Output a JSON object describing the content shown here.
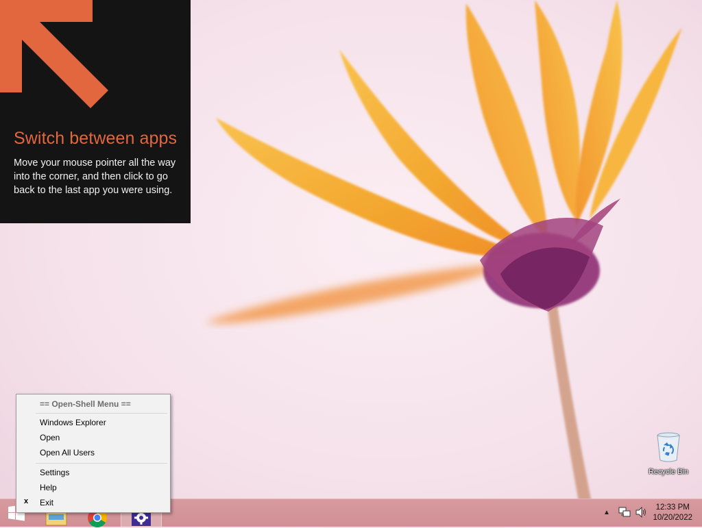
{
  "tip": {
    "title": "Switch between apps",
    "body": "Move your mouse pointer all the way into the corner, and then click to go back to the last app you were using.",
    "accent_color": "#e2663e",
    "icon": "arrow-up-left-icon"
  },
  "desktop": {
    "icons": [
      {
        "label": "Recycle Bin",
        "icon": "recycle-bin-icon"
      }
    ]
  },
  "context_menu": {
    "header": "== Open-Shell Menu ==",
    "items": [
      {
        "label": "Windows Explorer"
      },
      {
        "label": "Open"
      },
      {
        "label": "Open All Users"
      },
      {
        "label": "Settings"
      },
      {
        "label": "Help"
      },
      {
        "label": "Exit",
        "check": "x"
      }
    ]
  },
  "taskbar": {
    "buttons": [
      {
        "icon": "windows-start-icon"
      },
      {
        "icon": "file-explorer-icon"
      },
      {
        "icon": "chrome-icon"
      },
      {
        "icon": "open-shell-settings-icon",
        "active": true
      }
    ],
    "tray": {
      "icons": [
        "show-hidden-icons-chevron-icon",
        "network-icon",
        "volume-icon"
      ],
      "time": "12:33 PM",
      "date": "10/20/2022"
    }
  }
}
